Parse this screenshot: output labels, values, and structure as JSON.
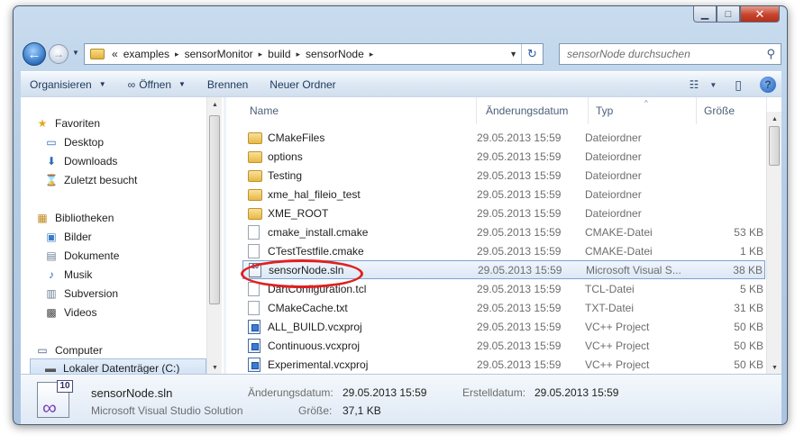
{
  "window": {
    "caption": {
      "minimize": "▁",
      "maximize": "□",
      "close": "✕"
    }
  },
  "nav": {
    "back_icon": "←",
    "forward_icon": "→",
    "dropdown_icon": "▼",
    "address_overflow": "«",
    "breadcrumbs": [
      "examples",
      "sensorMonitor",
      "build",
      "sensorNode"
    ],
    "crumb_sep": "▸",
    "address_dropdown": "▼",
    "refresh_icon": "↻",
    "search_placeholder": "sensorNode durchsuchen",
    "search_icon": "⚲"
  },
  "toolbar": {
    "organize": "Organisieren",
    "open": "Öffnen",
    "burn": "Brennen",
    "new_folder": "Neuer Ordner",
    "arrow": "▼",
    "open_icon": "∞",
    "view_icon": "☷",
    "preview_icon": "▯",
    "help": "?"
  },
  "sidebar": {
    "favorites": {
      "label": "Favoriten",
      "icon": "★"
    },
    "fav_items": [
      {
        "label": "Desktop",
        "icon": "▭"
      },
      {
        "label": "Downloads",
        "icon": "⬇"
      },
      {
        "label": "Zuletzt besucht",
        "icon": "⌛"
      }
    ],
    "libraries": {
      "label": "Bibliotheken",
      "icon": "▦"
    },
    "lib_items": [
      {
        "label": "Bilder",
        "icon": "▣"
      },
      {
        "label": "Dokumente",
        "icon": "▤"
      },
      {
        "label": "Musik",
        "icon": "♪"
      },
      {
        "label": "Subversion",
        "icon": "▥"
      },
      {
        "label": "Videos",
        "icon": "▩"
      }
    ],
    "computer": {
      "label": "Computer",
      "icon": "▭"
    },
    "drive": {
      "label": "Lokaler Datenträger (C:)",
      "icon": "▬"
    },
    "scroll_up": "▲",
    "scroll_down": "▼"
  },
  "columns": {
    "name": "Name",
    "date": "Änderungsdatum",
    "type": "Typ",
    "size": "Größe",
    "sort_caret": "^"
  },
  "files": [
    {
      "name": "CMakeFiles",
      "date": "29.05.2013 15:59",
      "type": "Dateiordner",
      "size": "",
      "kind": "folder"
    },
    {
      "name": "options",
      "date": "29.05.2013 15:59",
      "type": "Dateiordner",
      "size": "",
      "kind": "folder"
    },
    {
      "name": "Testing",
      "date": "29.05.2013 15:59",
      "type": "Dateiordner",
      "size": "",
      "kind": "folder"
    },
    {
      "name": "xme_hal_fileio_test",
      "date": "29.05.2013 15:59",
      "type": "Dateiordner",
      "size": "",
      "kind": "folder"
    },
    {
      "name": "XME_ROOT",
      "date": "29.05.2013 15:59",
      "type": "Dateiordner",
      "size": "",
      "kind": "folder"
    },
    {
      "name": "cmake_install.cmake",
      "date": "29.05.2013 15:59",
      "type": "CMAKE-Datei",
      "size": "53 KB",
      "kind": "file"
    },
    {
      "name": "CTestTestfile.cmake",
      "date": "29.05.2013 15:59",
      "type": "CMAKE-Datei",
      "size": "1 KB",
      "kind": "file"
    },
    {
      "name": "sensorNode.sln",
      "date": "29.05.2013 15:59",
      "type": "Microsoft Visual S...",
      "size": "38 KB",
      "kind": "sln"
    },
    {
      "name": "DartConfiguration.tcl",
      "date": "29.05.2013 15:59",
      "type": "TCL-Datei",
      "size": "5 KB",
      "kind": "file"
    },
    {
      "name": "CMakeCache.txt",
      "date": "29.05.2013 15:59",
      "type": "TXT-Datei",
      "size": "31 KB",
      "kind": "file"
    },
    {
      "name": "ALL_BUILD.vcxproj",
      "date": "29.05.2013 15:59",
      "type": "VC++ Project",
      "size": "50 KB",
      "kind": "proj"
    },
    {
      "name": "Continuous.vcxproj",
      "date": "29.05.2013 15:59",
      "type": "VC++ Project",
      "size": "50 KB",
      "kind": "proj"
    },
    {
      "name": "Experimental.vcxproj",
      "date": "29.05.2013 15:59",
      "type": "VC++ Project",
      "size": "50 KB",
      "kind": "proj"
    }
  ],
  "details": {
    "icon_badge": "10",
    "icon_glyph": "∞",
    "name": "sensorNode.sln",
    "type": "Microsoft Visual Studio Solution",
    "modified_label": "Änderungsdatum:",
    "modified_value": "29.05.2013 15:59",
    "created_label": "Erstelldatum:",
    "created_value": "29.05.2013 15:59",
    "size_label": "Größe:",
    "size_value": "37,1 KB"
  }
}
